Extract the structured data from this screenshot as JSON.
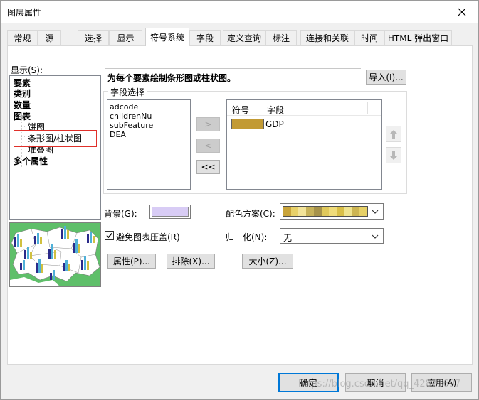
{
  "window": {
    "title": "图层属性"
  },
  "tabs": [
    "常规",
    "源",
    "选择",
    "显示",
    "符号系统",
    "字段",
    "定义查询",
    "标注",
    "连接和关联",
    "时间",
    "HTML 弹出窗口"
  ],
  "display_label": "显示(S):",
  "tree": {
    "items": [
      {
        "label": "要素",
        "bold": true
      },
      {
        "label": "类别",
        "bold": true
      },
      {
        "label": "数量",
        "bold": true
      },
      {
        "label": "图表",
        "bold": true
      },
      {
        "label": "饼图",
        "bold": false
      },
      {
        "label": "条形图/柱状图",
        "bold": false,
        "selected": true
      },
      {
        "label": "堆叠图",
        "bold": false
      },
      {
        "label": "多个属性",
        "bold": true
      }
    ]
  },
  "description": "为每个要素绘制条形图或柱状图。",
  "import_button": "导入(I)...",
  "field_group": {
    "title": "字段选择",
    "available_fields": [
      "adcode",
      "childrenNu",
      "subFeature",
      "DEA"
    ],
    "move_right": ">",
    "move_left": "<",
    "move_all_left": "<<",
    "selected_header_symbol": "符号",
    "selected_header_field": "字段",
    "selected_rows": [
      {
        "field": "GDP",
        "color": "#c29a34"
      }
    ]
  },
  "background_label": "背景(G):",
  "background_color": "#d8ccf5",
  "color_scheme_label": "配色方案(C):",
  "color_scheme_swatches": [
    "#c9a43a",
    "#e8d16a",
    "#f3e49a",
    "#c7b25a",
    "#a6924a",
    "#e0c95c",
    "#f0dc7a",
    "#d9bf48",
    "#efe38f",
    "#cdb552",
    "#e6d066"
  ],
  "prevent_overlap_label": "避免图表压盖(R)",
  "prevent_overlap_checked": true,
  "normalize_label": "归一化(N):",
  "normalize_value": "无",
  "properties_button": "属性(P)...",
  "exclude_button": "排除(X)...",
  "size_button": "大小(Z)...",
  "footer": {
    "ok": "确定",
    "cancel": "取消",
    "apply": "应用(A)"
  },
  "watermark": "https://blog.csdn.net/qq_42871697"
}
